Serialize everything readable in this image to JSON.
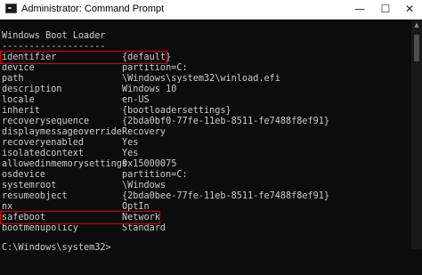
{
  "window": {
    "title": "Administrator: Command Prompt",
    "minimize_glyph": "—",
    "maximize_glyph": "☐",
    "close_glyph": "✕",
    "icon": "cmd-icon"
  },
  "terminal": {
    "header": "Windows Boot Loader",
    "separator": "-------------------",
    "entries": [
      {
        "key": "identifier",
        "value": "{default}"
      },
      {
        "key": "device",
        "value": "partition=C:"
      },
      {
        "key": "path",
        "value": "\\Windows\\system32\\winload.efi"
      },
      {
        "key": "description",
        "value": "Windows 10"
      },
      {
        "key": "locale",
        "value": "en-US"
      },
      {
        "key": "inherit",
        "value": "{bootloadersettings}"
      },
      {
        "key": "recoverysequence",
        "value": "{2bda0bf0-77fe-11eb-8511-fe7488f8ef91}"
      },
      {
        "key": "displaymessageoverride",
        "value": "Recovery"
      },
      {
        "key": "recoveryenabled",
        "value": "Yes"
      },
      {
        "key": "isolatedcontext",
        "value": "Yes"
      },
      {
        "key": "allowedinmemorysettings",
        "value": "0x15000075"
      },
      {
        "key": "osdevice",
        "value": "partition=C:"
      },
      {
        "key": "systemroot",
        "value": "\\Windows"
      },
      {
        "key": "resumeobject",
        "value": "{2bda0bee-77fe-11eb-8511-fe7488f8ef91}"
      },
      {
        "key": "nx",
        "value": "OptIn"
      },
      {
        "key": "safeboot",
        "value": "Network"
      },
      {
        "key": "bootmenupolicy",
        "value": "Standard"
      }
    ],
    "prompt": "C:\\Windows\\system32>"
  },
  "colors": {
    "terminal_bg": "#0c0c0c",
    "terminal_text": "#cccccc",
    "highlight_border": "#e00000"
  }
}
